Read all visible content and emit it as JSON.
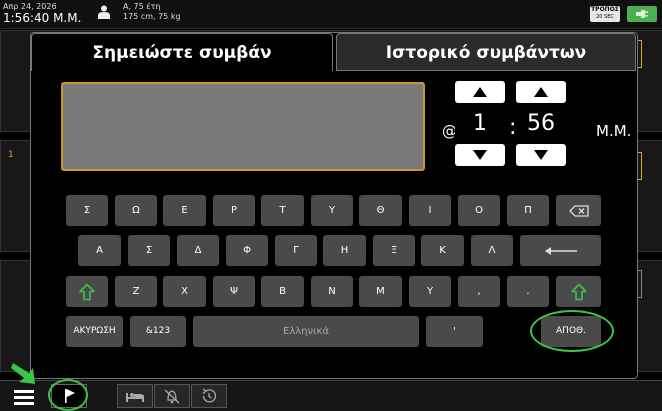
{
  "status_bar": {
    "date": "Απρ 24, 2026",
    "time": "1:56:40 Μ.Μ.",
    "patient_line1": "Α, 75 έτη",
    "patient_line2": "175 cm, 75 kg",
    "mode_label": "ΤΡΟΠΟΣ",
    "mode_interval": "20 SEC",
    "battery_color": "#4caf50"
  },
  "background": {
    "partial_number": "1"
  },
  "dialog": {
    "tabs": [
      {
        "label": "Σημειώστε συμβάν",
        "active": true
      },
      {
        "label": "Ιστορικό συμβάντων",
        "active": false
      }
    ],
    "note_value": "",
    "note_border_color": "#c89a2a",
    "time_prefix": "@",
    "time_hour": "1",
    "time_separator": ":",
    "time_minute": "56",
    "time_period": "Μ.Μ."
  },
  "keyboard": {
    "row1": [
      "Σ",
      "Ω",
      "Ε",
      "Ρ",
      "Τ",
      "Υ",
      "Θ",
      "Ι",
      "Ο",
      "Π"
    ],
    "row2": [
      "Α",
      "Σ",
      "Δ",
      "Φ",
      "Γ",
      "Η",
      "Ξ",
      "Κ",
      "Λ"
    ],
    "row3": [
      "Ζ",
      "Χ",
      "Ψ",
      "Β",
      "Ν",
      "Μ",
      "Υ",
      ",",
      "."
    ],
    "cancel_label": "ΑΚΥΡΩΣΗ",
    "symbols_label": "&123",
    "space_label": "Ελληνικά",
    "accent_label": "'",
    "save_label": "ΑΠΟΘ.",
    "shift_color": "#3cc44a",
    "highlight_color": "#3cc44a"
  }
}
